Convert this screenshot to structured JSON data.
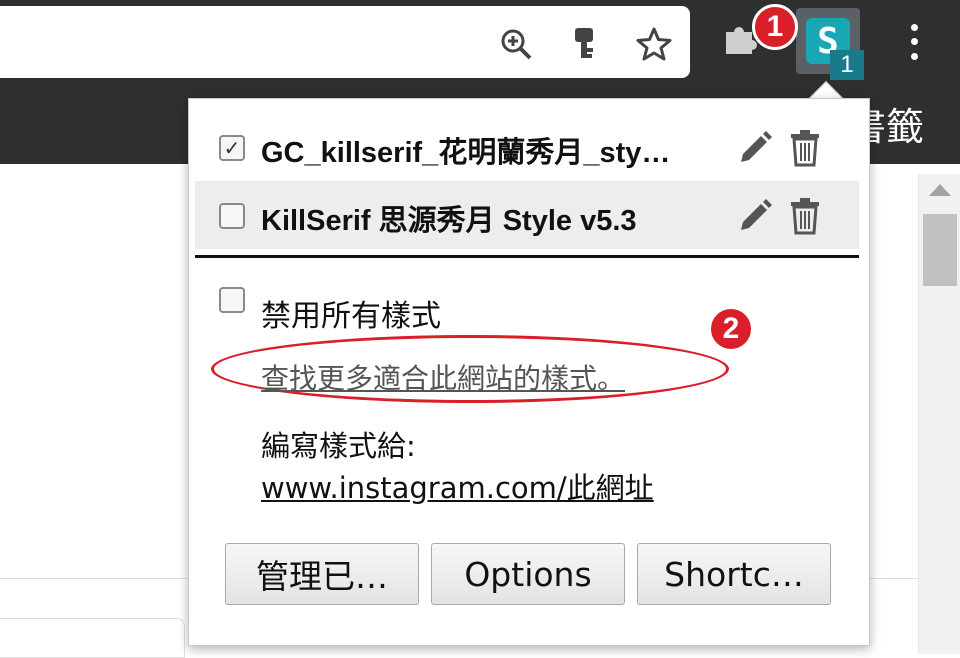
{
  "browser": {
    "bookmark_bar_text": "書籤",
    "extension_badge": "1",
    "stylus_glyph": "S"
  },
  "popup": {
    "styles": [
      {
        "name": "GC_killserif_花明蘭秀月_sty…",
        "checked": true
      },
      {
        "name": "KillSerif 思源秀月 Style v5.3",
        "checked": false
      }
    ],
    "disable_all": {
      "label": "禁用所有樣式",
      "checked": false
    },
    "find_more_link": "查找更多適合此網站的樣式。",
    "write_style_label": "編寫樣式給:",
    "write_style_url": "www.instagram.com/此網址",
    "buttons": {
      "manage": "管理已…",
      "options": "Options",
      "shortcuts": "Shortc…"
    }
  },
  "markers": {
    "first": "1",
    "second": "2"
  },
  "colors": {
    "marker_red": "#d81f2a",
    "stylus_teal": "#1aa7b5",
    "chrome_dark": "#2f2f2f"
  },
  "icons": [
    "zoom-in-icon",
    "key-icon",
    "star-icon",
    "puzzle-icon",
    "stylus-icon",
    "menu-kebab-icon",
    "pencil-icon",
    "trash-icon"
  ]
}
